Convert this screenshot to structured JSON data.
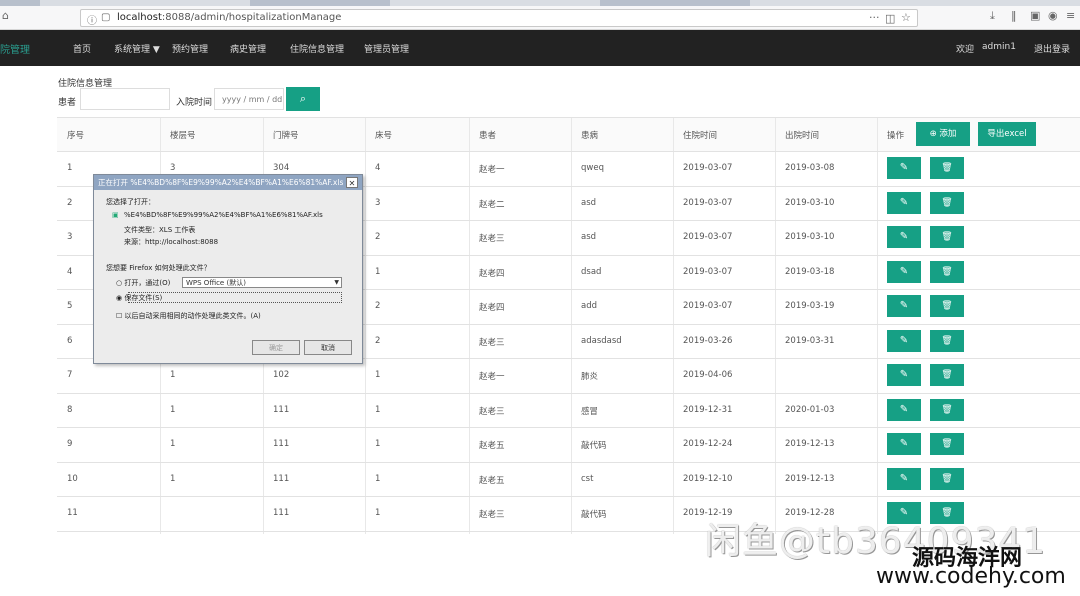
{
  "browser": {
    "url_host": "localhost",
    "url_rest": ":8088/admin/hospitalizationManage",
    "menu_dots": "···"
  },
  "navbar": {
    "brand": "院管理",
    "items": [
      "首页",
      "系统管理 ▼",
      "预约管理",
      "病史管理",
      "住院信息管理",
      "管理员管理"
    ],
    "welcome": "欢迎",
    "user": "admin1",
    "logout": "退出登录"
  },
  "search": {
    "section_title": "住院信息管理",
    "patient_label": "患者",
    "date_label": "入院时间",
    "date_placeholder": "yyyy / mm / dd"
  },
  "table": {
    "headers": [
      "序号",
      "楼层号",
      "门牌号",
      "床号",
      "患者",
      "患病",
      "住院时间",
      "出院时间",
      "操作"
    ],
    "add_label": "添加",
    "export_label": "导出excel",
    "edit_icon": "✎",
    "delete_icon": "🗑",
    "rows": [
      [
        "1",
        "3",
        "304",
        "4",
        "赵老一",
        "qweq",
        "2019-03-07",
        "2019-03-08"
      ],
      [
        "2",
        "",
        "",
        "3",
        "赵老二",
        "asd",
        "2019-03-07",
        "2019-03-10"
      ],
      [
        "3",
        "",
        "",
        "2",
        "赵老三",
        "asd",
        "2019-03-07",
        "2019-03-10"
      ],
      [
        "4",
        "",
        "",
        "1",
        "赵老四",
        "dsad",
        "2019-03-07",
        "2019-03-18"
      ],
      [
        "5",
        "",
        "",
        "2",
        "赵老四",
        "add",
        "2019-03-07",
        "2019-03-19"
      ],
      [
        "6",
        "",
        "",
        "2",
        "赵老三",
        "adasdasd",
        "2019-03-26",
        "2019-03-31"
      ],
      [
        "7",
        "1",
        "102",
        "1",
        "赵老一",
        "肺炎",
        "2019-04-06",
        ""
      ],
      [
        "8",
        "1",
        "111",
        "1",
        "赵老三",
        "感冒",
        "2019-12-31",
        "2020-01-03"
      ],
      [
        "9",
        "1",
        "111",
        "1",
        "赵老五",
        "敲代码",
        "2019-12-24",
        "2019-12-13"
      ],
      [
        "10",
        "1",
        "111",
        "1",
        "赵老五",
        "cst",
        "2019-12-10",
        "2019-12-13"
      ],
      [
        "11",
        "",
        "111",
        "1",
        "赵老三",
        "敲代码",
        "2019-12-19",
        "2019-12-28"
      ]
    ]
  },
  "dialog": {
    "title": "正在打开 %E4%BD%8F%E9%99%A2%E4%BF%A1%E6%81%AF.xls",
    "intro": "您选择了打开：",
    "filename": "%E4%BD%8F%E9%99%A2%E4%BF%A1%E6%81%AF.xls",
    "file_type": "文件类型：XLS 工作表",
    "source": "来源：http://localhost:8088",
    "question": "您想要 Firefox 如何处理此文件？",
    "open_with": "打开，通过(O)",
    "app": "WPS Office (默认)",
    "save_file": "保存文件(S)",
    "remember": "以后自动采用相同的动作处理此类文件。(A)",
    "ok": "确定",
    "cancel": "取消"
  },
  "watermark": {
    "line1": "闲鱼@tb36409341",
    "line2": "源码海洋网",
    "line3": "www.codehy.com"
  }
}
